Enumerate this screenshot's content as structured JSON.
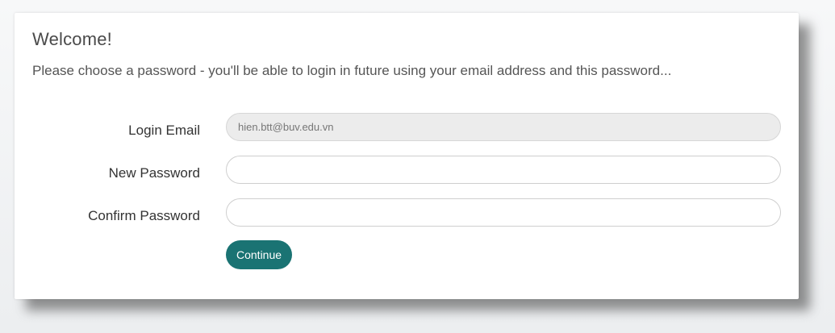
{
  "form": {
    "title": "Welcome!",
    "intro": "Please choose a password - you'll be able to login in future using your email address and this password...",
    "login_email_label": "Login Email",
    "login_email_value": "hien.btt@buv.edu.vn",
    "new_password_label": "New Password",
    "new_password_value": "",
    "confirm_password_label": "Confirm Password",
    "confirm_password_value": "",
    "continue_label": "Continue"
  },
  "colors": {
    "accent": "#1a7373",
    "readonly_field_bg": "#ececec"
  }
}
